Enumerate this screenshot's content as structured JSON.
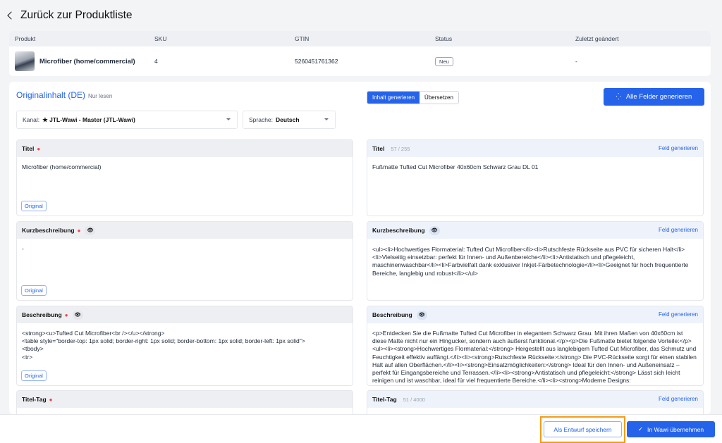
{
  "back": {
    "label": "Zurück zur Produktliste"
  },
  "product_table": {
    "headers": {
      "product": "Produkt",
      "sku": "SKU",
      "gtin": "GTIN",
      "status": "Status",
      "changed": "Zuletzt geändert"
    },
    "row": {
      "name": "Microfiber (home/commercial)",
      "sku": "4",
      "gtin": "5260451761362",
      "status": "Neu",
      "changed": "-"
    }
  },
  "section": {
    "title": "Originalinhalt (DE)",
    "readonly": "Nur lesen",
    "tab_generate": "Inhalt generieren",
    "tab_translate": "Übersetzen",
    "generate_all": "Alle Felder generieren",
    "channel_label": "Kanal:",
    "channel_value": "★ JTL-Wawi - Master (JTL-Wawi)",
    "language_label": "Sprache:",
    "language_value": "Deutsch"
  },
  "original_badge": "Original",
  "field_generate": "Feld generieren",
  "left_fields": [
    {
      "label": "Titel",
      "value": "Microfiber (home/commercial)"
    },
    {
      "label": "Kurzbeschreibung",
      "value": "-"
    },
    {
      "label": "Beschreibung",
      "value": "<strong><u>Tufted Cut Microfiber<br /></u></strong>\n<table style=\"border-top: 1px solid; border-right: 1px solid; border-bottom: 1px solid; border-left: 1px solid\">\n<tbody>\n<tr>"
    },
    {
      "label": "Titel-Tag",
      "value": ""
    }
  ],
  "right_fields": [
    {
      "label": "Titel",
      "count": "57 / 255",
      "value": "Fußmatte Tufted Cut Microfiber 40x60cm Schwarz Grau DL 01"
    },
    {
      "label": "Kurzbeschreibung",
      "count": "",
      "value": "<ul><li>Hochwertiges Flormaterial: Tufted Cut Microfiber</li><li>Rutschfeste Rückseite aus PVC für sicheren Halt</li><li>Vielseitig einsetzbar: perfekt für Innen- und Außenbereiche</li><li>Antistatisch und pflegeleicht, maschinenwaschbar</li><li>Farbvielfalt dank exklusiver Inkjet-Färbetechnologie</li><li>Geeignet für hoch frequentierte Bereiche, langlebig und robust</li></ul>"
    },
    {
      "label": "Beschreibung",
      "count": "",
      "value": "<p>Entdecken Sie die Fußmatte Tufted Cut Microfiber in elegantem Schwarz Grau. Mit ihren Maßen von 40x60cm ist diese Matte nicht nur ein Hingucker, sondern auch äußerst funktional.</p><p>Die Fußmatte bietet folgende Vorteile:</p><ul><li><strong>Hochwertiges Flormaterial:</strong> Hergestellt aus langlebigem Tufted Cut Microfiber, das Schmutz und Feuchtigkeit effektiv auffängt.</li><li><strong>Rutschfeste Rückseite:</strong> Die PVC-Rückseite sorgt für einen stabilen Halt auf allen Oberflächen.</li><li><strong>Einsatzmöglichkeiten:</strong> Ideal für den Innen- und Außeneinsatz – perfekt für Eingangsbereiche und Terrassen.</li><li><strong>Antistatisch und pflegeleicht:</strong> Lässt sich leicht reinigen und ist waschbar, ideal für viel frequentierte Bereiche.</li><li><strong>Moderne Designs:"
    },
    {
      "label": "Titel-Tag",
      "count": "51 / 4000",
      "value": ""
    }
  ],
  "footer": {
    "draft": "Als Entwurf speichern",
    "apply": "In Wawi übernehmen"
  }
}
